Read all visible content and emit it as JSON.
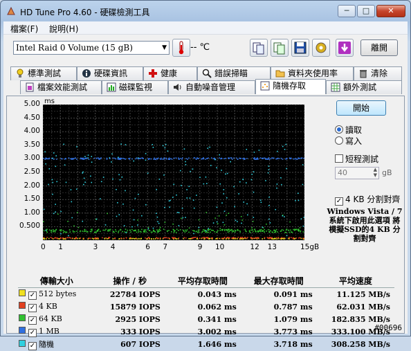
{
  "window": {
    "title": "HD Tune Pro 4.60 - 硬碟檢測工具",
    "minimize": "─",
    "maximize": "□",
    "close": "✕"
  },
  "menu": [
    "檔案(F)",
    "說明(H)"
  ],
  "toolbar": {
    "drive": "Intel  Raid 0 Volume (15 gB)",
    "temperature": "-- ℃",
    "exit_label": "離開"
  },
  "tabs_row1": [
    "標準測試",
    "硬碟資訊",
    "健康",
    "錯誤掃瞄",
    "資料夾使用率",
    "清除"
  ],
  "tabs_row2": [
    "檔案效能測試",
    "磁碟監視",
    "自動噪音管理",
    "隨機存取",
    "額外測試"
  ],
  "active_tab": "隨機存取",
  "side": {
    "start_label": "開始",
    "read_label": "讀取",
    "write_label": "寫入",
    "mode_selected": "read",
    "short_test_label": "短程測試",
    "short_test_checked": false,
    "size_value": "40",
    "size_unit": "gB",
    "align_label": "4 KB 分割對齊",
    "align_checked": true,
    "note": "Windows Vista / 7 系統下啟用此選項 將模擬SSD的4 KB 分割對齊"
  },
  "chart_data": {
    "type": "scatter",
    "ylabel": "ms",
    "xlabel": "gB",
    "xlim": [
      0,
      15
    ],
    "ylim": [
      0,
      5
    ],
    "xticks": [
      "0",
      "1",
      "3",
      "4",
      "6",
      "7",
      "9",
      "10",
      "12",
      "13",
      "15gB"
    ],
    "xtick_values": [
      0,
      1,
      3,
      4,
      6,
      7,
      9,
      10,
      12,
      13,
      15
    ],
    "yticks": [
      "5.00",
      "4.50",
      "4.00",
      "3.50",
      "3.00",
      "2.50",
      "2.00",
      "1.50",
      "1.00",
      "0.500"
    ],
    "ytick_values": [
      5,
      4.5,
      4,
      3.5,
      3,
      2.5,
      2,
      1.5,
      1,
      0.5
    ],
    "grid": true,
    "series": [
      {
        "name": "512 bytes",
        "color": "#f0e020",
        "avg_ms": 0.043
      },
      {
        "name": "4 KB",
        "color": "#e04020",
        "avg_ms": 0.062
      },
      {
        "name": "64 KB",
        "color": "#30c030",
        "avg_ms": 0.341
      },
      {
        "name": "1 MB",
        "color": "#3070e0",
        "avg_ms": 3.002
      },
      {
        "name": "隨機",
        "color": "#30d0e0",
        "avg_ms": 1.646
      }
    ]
  },
  "results": {
    "headers": [
      "傳輸大小",
      "操作 / 秒",
      "平均存取時間",
      "最大存取時間",
      "平均速度"
    ],
    "rows": [
      {
        "label": "512 bytes",
        "color": "#f0e020",
        "ops": "22784 IOPS",
        "avg": "0.043 ms",
        "max": "0.091 ms",
        "speed": "11.125 MB/s"
      },
      {
        "label": "4 KB",
        "color": "#e04020",
        "ops": "15879 IOPS",
        "avg": "0.062 ms",
        "max": "0.787 ms",
        "speed": "62.031 MB/s"
      },
      {
        "label": "64 KB",
        "color": "#30c030",
        "ops": "2925 IOPS",
        "avg": "0.341 ms",
        "max": "1.079 ms",
        "speed": "182.835 MB/s"
      },
      {
        "label": "1 MB",
        "color": "#3070e0",
        "ops": "333 IOPS",
        "avg": "3.002 ms",
        "max": "3.773 ms",
        "speed": "333.100 MB/s"
      },
      {
        "label": "隨機",
        "color": "#30d0e0",
        "ops": "607 IOPS",
        "avg": "1.646 ms",
        "max": "3.718 ms",
        "speed": "308.258 MB/s"
      }
    ]
  },
  "watermark": "#00696"
}
